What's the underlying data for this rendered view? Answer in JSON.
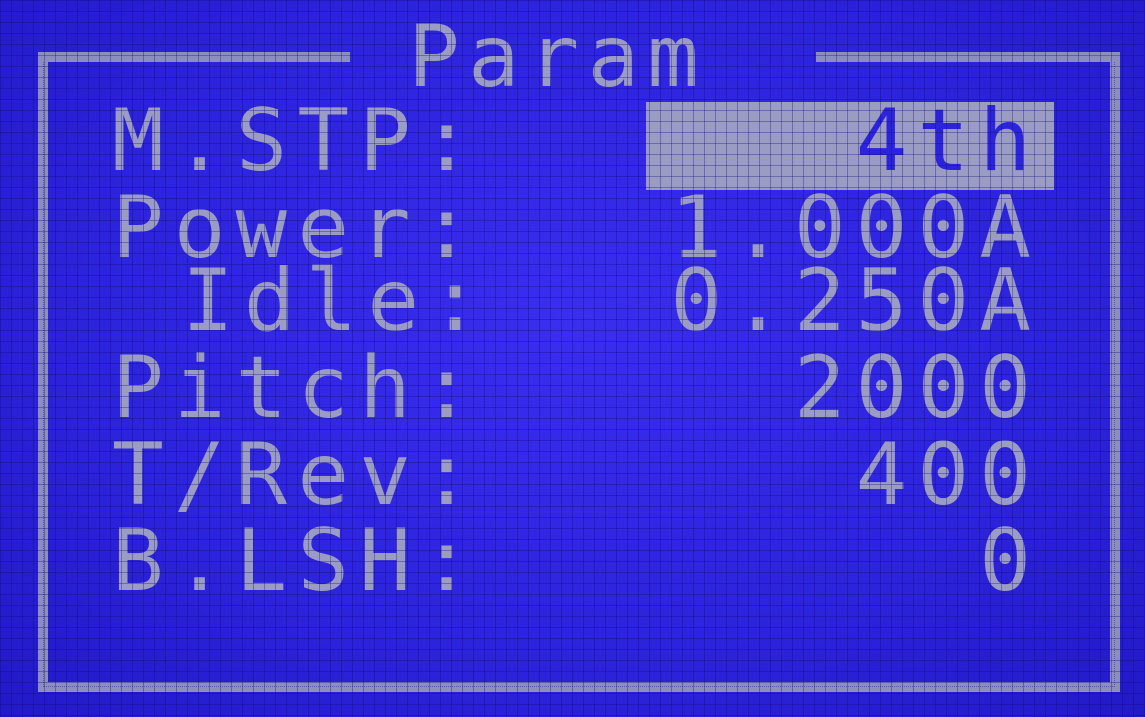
{
  "screen": {
    "title": "Param"
  },
  "params": {
    "mstp": {
      "label": "M.STP:",
      "value": "4th"
    },
    "power": {
      "label": "Power:",
      "value": "1.000A"
    },
    "idle": {
      "label": "Idle:",
      "value": "0.250A"
    },
    "pitch": {
      "label": "Pitch:",
      "value": "2000"
    },
    "trev": {
      "label": "T/Rev:",
      "value": "400"
    },
    "blsh": {
      "label": "B.LSH:",
      "value": "0"
    }
  },
  "colors": {
    "background": "#2c23dc",
    "pixel_on": "#9a9cc4"
  },
  "selected_param": "mstp"
}
